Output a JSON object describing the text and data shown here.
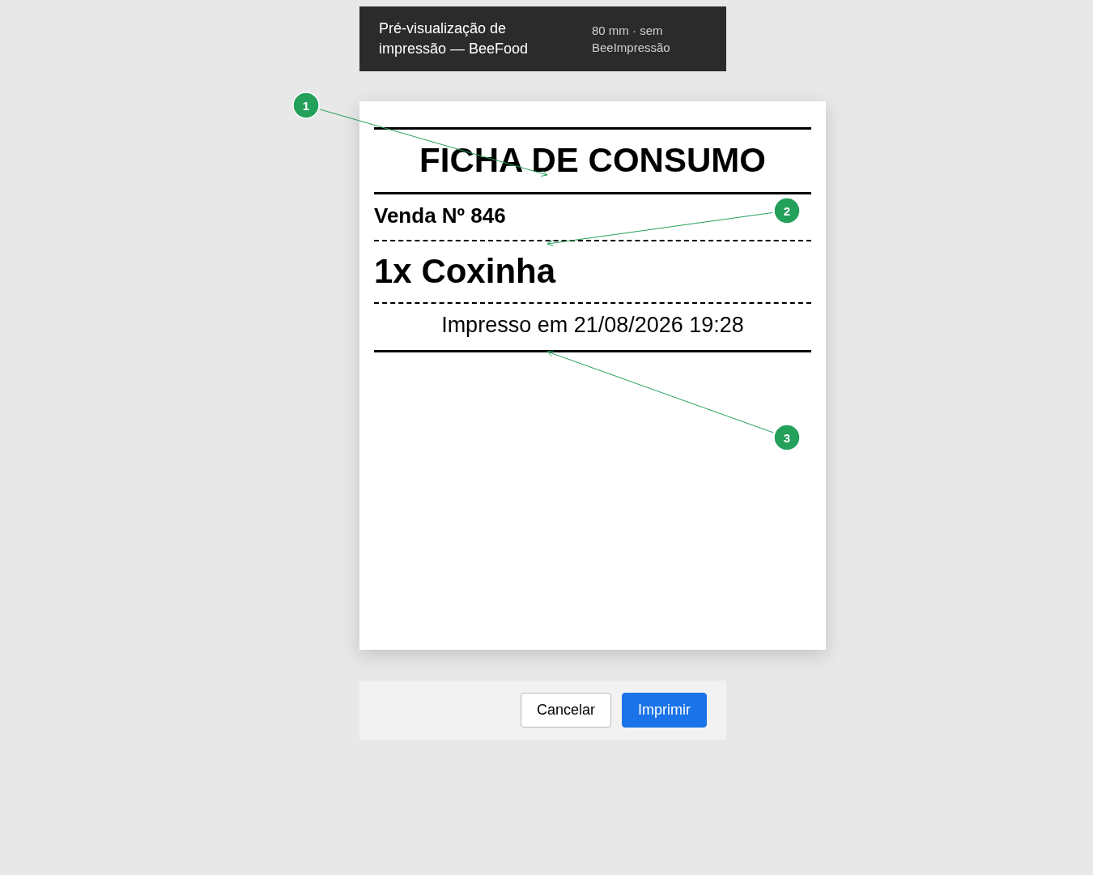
{
  "header": {
    "title": "Pré-visualização de impressão — BeeFood",
    "subtitle": "80 mm · sem BeeImpressão"
  },
  "receipt": {
    "title": "FICHA DE CONSUMO",
    "sale": "Venda Nº 846",
    "items": [
      "1x Coxinha"
    ],
    "printed_at": "Impresso em 21/08/2026 19:28"
  },
  "buttons": [
    {
      "label": "Cancelar",
      "kind": "secondary"
    },
    {
      "label": "Imprimir",
      "kind": "primary"
    }
  ],
  "callouts": [
    {
      "label": "1"
    },
    {
      "label": "2"
    },
    {
      "label": "3"
    }
  ]
}
